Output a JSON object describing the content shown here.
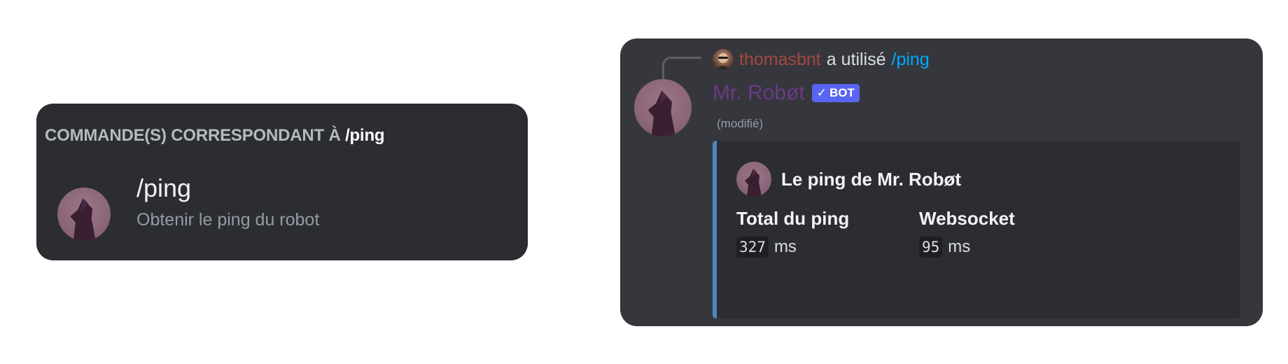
{
  "command_suggestions": {
    "header_prefix": "COMMANDE(S) CORRESPONDANT À",
    "header_query": "/ping",
    "items": [
      {
        "name": "/ping",
        "description": "Obtenir le ping du robot",
        "icon": "robot-avatar-icon"
      }
    ]
  },
  "message": {
    "reply": {
      "username": "thomasbnt",
      "action_text": "a utilisé",
      "command": "/ping",
      "icon": "user-avatar-icon"
    },
    "author": {
      "name": "Mr. Robøt",
      "badge": "BOT",
      "badge_check": "✓",
      "icon": "robot-avatar-icon"
    },
    "edited_label": "(modifié)",
    "embed": {
      "author_name": "Le ping de Mr. Robøt",
      "fields": [
        {
          "name": "Total du ping",
          "value": "327",
          "unit": "ms"
        },
        {
          "name": "Websocket",
          "value": "95",
          "unit": "ms"
        }
      ]
    }
  },
  "colors": {
    "card_bg": "#2b2d31",
    "message_bg": "#36373d",
    "embed_accent": "#4b87c1",
    "bot_badge": "#5865f2",
    "author_name": "#6b3b86",
    "reply_user": "#a3483f",
    "reply_command": "#00a8fc"
  }
}
